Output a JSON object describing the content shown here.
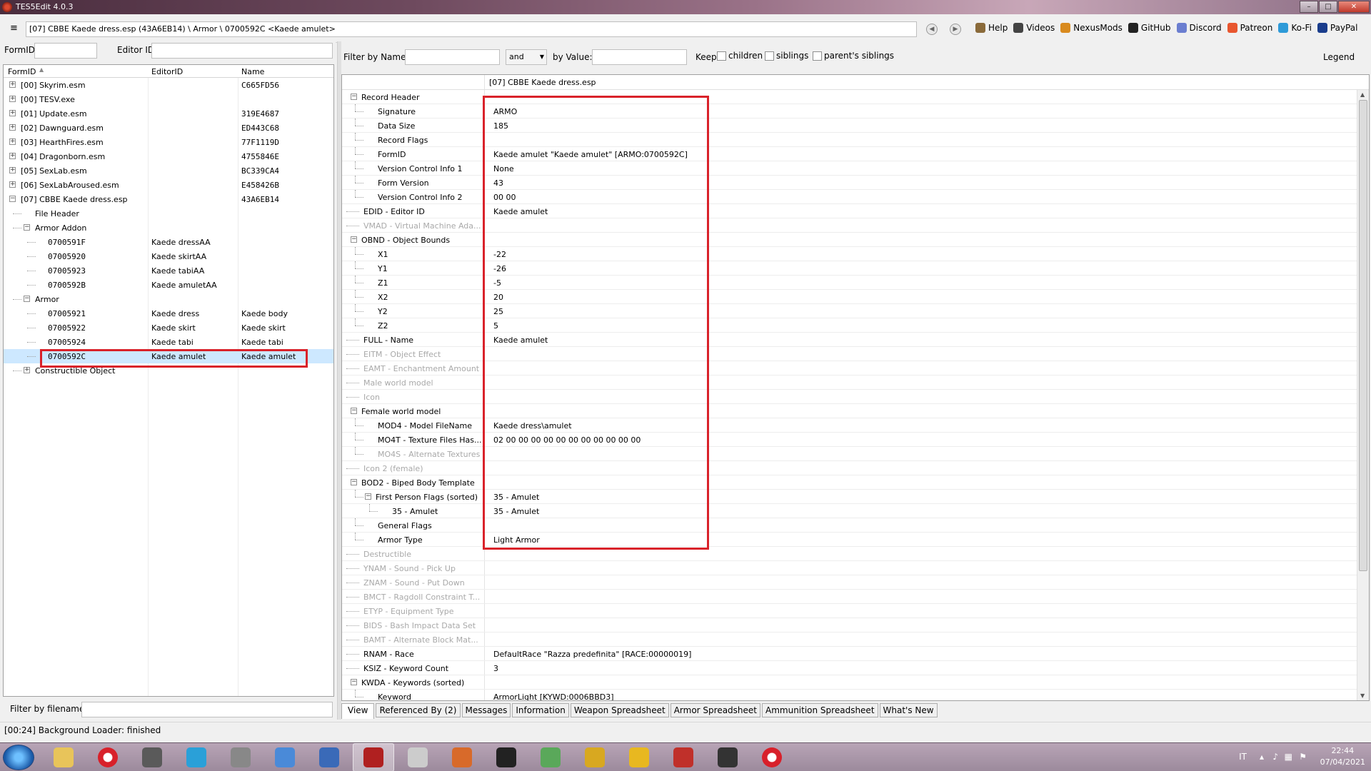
{
  "window": {
    "title": "TES5Edit 4.0.3"
  },
  "toolbar": {
    "path": "[07] CBBE Kaede dress.esp (43A6EB14) \\ Armor \\ 0700592C <Kaede amulet>",
    "links": [
      {
        "label": "Help",
        "icon": "book-icon",
        "color": "#8a6a3a"
      },
      {
        "label": "Videos",
        "icon": "video-icon",
        "color": "#444444"
      },
      {
        "label": "NexusMods",
        "icon": "nexus-icon",
        "color": "#d98a1e"
      },
      {
        "label": "GitHub",
        "icon": "github-icon",
        "color": "#222222"
      },
      {
        "label": "Discord",
        "icon": "discord-icon",
        "color": "#6b7ed0"
      },
      {
        "label": "Patreon",
        "icon": "patreon-icon",
        "color": "#e8562f"
      },
      {
        "label": "Ko-Fi",
        "icon": "kofi-icon",
        "color": "#2e9ad8"
      },
      {
        "label": "PayPal",
        "icon": "paypal-icon",
        "color": "#1a3d8c"
      }
    ],
    "legend": "Legend"
  },
  "left": {
    "formid_label": "FormID",
    "editorid_label": "Editor ID",
    "columns": [
      "FormID",
      "EditorID",
      "Name"
    ],
    "rows": [
      {
        "level": 0,
        "exp": "+",
        "formid": "[00] Skyrim.esm",
        "editorid": "",
        "name": "C665FD56",
        "mono": false
      },
      {
        "level": 0,
        "exp": "+",
        "formid": "[00] TESV.exe",
        "editorid": "",
        "name": "",
        "mono": false
      },
      {
        "level": 0,
        "exp": "+",
        "formid": "[01] Update.esm",
        "editorid": "",
        "name": "319E4687",
        "mono": false
      },
      {
        "level": 0,
        "exp": "+",
        "formid": "[02] Dawnguard.esm",
        "editorid": "",
        "name": "ED443C68",
        "mono": false
      },
      {
        "level": 0,
        "exp": "+",
        "formid": "[03] HearthFires.esm",
        "editorid": "",
        "name": "77F1119D",
        "mono": false
      },
      {
        "level": 0,
        "exp": "+",
        "formid": "[04] Dragonborn.esm",
        "editorid": "",
        "name": "4755846E",
        "mono": false
      },
      {
        "level": 0,
        "exp": "+",
        "formid": "[05] SexLab.esm",
        "editorid": "",
        "name": "BC339CA4",
        "mono": false
      },
      {
        "level": 0,
        "exp": "+",
        "formid": "[06] SexLabAroused.esm",
        "editorid": "",
        "name": "E458426B",
        "mono": false
      },
      {
        "level": 0,
        "exp": "-",
        "formid": "[07] CBBE Kaede dress.esp",
        "editorid": "",
        "name": "43A6EB14",
        "mono": false
      },
      {
        "level": 1,
        "exp": "",
        "formid": "File Header",
        "editorid": "",
        "name": "",
        "mono": false
      },
      {
        "level": 1,
        "exp": "-",
        "formid": "Armor Addon",
        "editorid": "",
        "name": "",
        "mono": false
      },
      {
        "level": 2,
        "exp": "",
        "formid": "0700591F",
        "editorid": "Kaede dressAA",
        "name": "",
        "mono": true
      },
      {
        "level": 2,
        "exp": "",
        "formid": "07005920",
        "editorid": "Kaede skirtAA",
        "name": "",
        "mono": true
      },
      {
        "level": 2,
        "exp": "",
        "formid": "07005923",
        "editorid": "Kaede tabiAA",
        "name": "",
        "mono": true
      },
      {
        "level": 2,
        "exp": "",
        "formid": "0700592B",
        "editorid": "Kaede amuletAA",
        "name": "",
        "mono": true
      },
      {
        "level": 1,
        "exp": "-",
        "formid": "Armor",
        "editorid": "",
        "name": "",
        "mono": false
      },
      {
        "level": 2,
        "exp": "",
        "formid": "07005921",
        "editorid": "Kaede dress",
        "name": "Kaede body",
        "mono": true
      },
      {
        "level": 2,
        "exp": "",
        "formid": "07005922",
        "editorid": "Kaede skirt",
        "name": "Kaede skirt",
        "mono": true
      },
      {
        "level": 2,
        "exp": "",
        "formid": "07005924",
        "editorid": "Kaede tabi",
        "name": "Kaede tabi",
        "mono": true
      },
      {
        "level": 2,
        "exp": "",
        "formid": "0700592C",
        "editorid": "Kaede amulet",
        "name": "Kaede amulet",
        "mono": true,
        "selected": true
      },
      {
        "level": 1,
        "exp": "+",
        "formid": "Constructible Object",
        "editorid": "",
        "name": "",
        "mono": false
      }
    ],
    "filter_label": "Filter by filename:"
  },
  "filter": {
    "by_name_label": "Filter by Name:",
    "and_value": "and",
    "by_value_label": "by Value:",
    "keep_label": "Keep",
    "children_label": "children",
    "siblings_label": "siblings",
    "parents_siblings_label": "parent's siblings"
  },
  "grid": {
    "column_header": "[07] CBBE Kaede dress.esp",
    "rows": [
      {
        "level": 0,
        "exp": "-",
        "name": "Record Header",
        "value": "",
        "dis": false
      },
      {
        "level": 1,
        "exp": "",
        "name": "Signature",
        "value": "ARMO",
        "dis": false
      },
      {
        "level": 1,
        "exp": "",
        "name": "Data Size",
        "value": "185",
        "dis": false
      },
      {
        "level": 1,
        "exp": "",
        "name": "Record Flags",
        "value": "",
        "dis": false
      },
      {
        "level": 1,
        "exp": "",
        "name": "FormID",
        "value": "Kaede amulet \"Kaede amulet\" [ARMO:0700592C]",
        "dis": false
      },
      {
        "level": 1,
        "exp": "",
        "name": "Version Control Info 1",
        "value": "None",
        "dis": false
      },
      {
        "level": 1,
        "exp": "",
        "name": "Form Version",
        "value": "43",
        "dis": false
      },
      {
        "level": 1,
        "exp": "",
        "name": "Version Control Info 2",
        "value": "00 00",
        "dis": false
      },
      {
        "level": 0,
        "exp": "",
        "name": "EDID - Editor ID",
        "value": "Kaede amulet",
        "dis": false
      },
      {
        "level": 0,
        "exp": "",
        "name": "VMAD - Virtual Machine Ada...",
        "value": "",
        "dis": true
      },
      {
        "level": 0,
        "exp": "-",
        "name": "OBND - Object Bounds",
        "value": "",
        "dis": false
      },
      {
        "level": 1,
        "exp": "",
        "name": "X1",
        "value": "-22",
        "dis": false
      },
      {
        "level": 1,
        "exp": "",
        "name": "Y1",
        "value": "-26",
        "dis": false
      },
      {
        "level": 1,
        "exp": "",
        "name": "Z1",
        "value": "-5",
        "dis": false
      },
      {
        "level": 1,
        "exp": "",
        "name": "X2",
        "value": "20",
        "dis": false
      },
      {
        "level": 1,
        "exp": "",
        "name": "Y2",
        "value": "25",
        "dis": false
      },
      {
        "level": 1,
        "exp": "",
        "name": "Z2",
        "value": "5",
        "dis": false
      },
      {
        "level": 0,
        "exp": "",
        "name": "FULL - Name",
        "value": "Kaede amulet",
        "dis": false
      },
      {
        "level": 0,
        "exp": "",
        "name": "EITM - Object Effect",
        "value": "",
        "dis": true
      },
      {
        "level": 0,
        "exp": "",
        "name": "EAMT - Enchantment Amount",
        "value": "",
        "dis": true
      },
      {
        "level": 0,
        "exp": "",
        "name": "Male world model",
        "value": "",
        "dis": true
      },
      {
        "level": 0,
        "exp": "",
        "name": "Icon",
        "value": "",
        "dis": true
      },
      {
        "level": 0,
        "exp": "-",
        "name": "Female world model",
        "value": "",
        "dis": false
      },
      {
        "level": 1,
        "exp": "",
        "name": "MOD4 - Model FileName",
        "value": "Kaede dress\\amulet",
        "dis": false
      },
      {
        "level": 1,
        "exp": "",
        "name": "MO4T - Texture Files Has...",
        "value": "02 00 00 00 00 00 00 00 00 00 00 00",
        "dis": false
      },
      {
        "level": 1,
        "exp": "",
        "name": "MO4S - Alternate Textures",
        "value": "",
        "dis": true
      },
      {
        "level": 0,
        "exp": "",
        "name": "Icon 2 (female)",
        "value": "",
        "dis": true
      },
      {
        "level": 0,
        "exp": "-",
        "name": "BOD2 - Biped Body Template",
        "value": "",
        "dis": false
      },
      {
        "level": 1,
        "exp": "-",
        "name": "First Person Flags (sorted)",
        "value": "35 - Amulet",
        "dis": false
      },
      {
        "level": 2,
        "exp": "",
        "name": "35 - Amulet",
        "value": "35 - Amulet",
        "dis": false
      },
      {
        "level": 1,
        "exp": "",
        "name": "General Flags",
        "value": "",
        "dis": false
      },
      {
        "level": 1,
        "exp": "",
        "name": "Armor Type",
        "value": "Light Armor",
        "dis": false
      },
      {
        "level": 0,
        "exp": "",
        "name": "Destructible",
        "value": "",
        "dis": true
      },
      {
        "level": 0,
        "exp": "",
        "name": "YNAM - Sound - Pick Up",
        "value": "",
        "dis": true
      },
      {
        "level": 0,
        "exp": "",
        "name": "ZNAM - Sound - Put Down",
        "value": "",
        "dis": true
      },
      {
        "level": 0,
        "exp": "",
        "name": "BMCT - Ragdoll Constraint T...",
        "value": "",
        "dis": true
      },
      {
        "level": 0,
        "exp": "",
        "name": "ETYP - Equipment Type",
        "value": "",
        "dis": true
      },
      {
        "level": 0,
        "exp": "",
        "name": "BIDS - Bash Impact Data Set",
        "value": "",
        "dis": true
      },
      {
        "level": 0,
        "exp": "",
        "name": "BAMT - Alternate Block Mat...",
        "value": "",
        "dis": true
      },
      {
        "level": 0,
        "exp": "",
        "name": "RNAM - Race",
        "value": "DefaultRace \"Razza predefinita\" [RACE:00000019]",
        "dis": false
      },
      {
        "level": 0,
        "exp": "",
        "name": "KSIZ - Keyword Count",
        "value": "3",
        "dis": false
      },
      {
        "level": 0,
        "exp": "-",
        "name": "KWDA - Keywords (sorted)",
        "value": "",
        "dis": false
      },
      {
        "level": 1,
        "exp": "",
        "name": "Keyword",
        "value": "ArmorLight [KYWD:0006BBD3]",
        "dis": false
      }
    ]
  },
  "tabs": [
    "View",
    "Referenced By (2)",
    "Messages",
    "Information",
    "Weapon Spreadsheet",
    "Armor Spreadsheet",
    "Ammunition Spreadsheet",
    "What's New"
  ],
  "status": {
    "text": "[00:24] Background Loader: finished"
  },
  "taskbar": {
    "apps": [
      {
        "name": "explorer-icon",
        "color": "#e8c45a"
      },
      {
        "name": "opera-icon",
        "color": "#d8202a"
      },
      {
        "name": "media-icon",
        "color": "#5a5a5a"
      },
      {
        "name": "music-icon",
        "color": "#2aa0d8"
      },
      {
        "name": "speaker-icon",
        "color": "#888888"
      },
      {
        "name": "ffdec-icon",
        "color": "#4a8ad8"
      },
      {
        "name": "pen-icon",
        "color": "#3a6ab8"
      },
      {
        "name": "tes5edit-icon",
        "color": "#b02020"
      },
      {
        "name": "robot-icon",
        "color": "#cccccc"
      },
      {
        "name": "headphones-icon",
        "color": "#d86a2a"
      },
      {
        "name": "mm-icon",
        "color": "#222222"
      },
      {
        "name": "calc-icon",
        "color": "#5aa85a"
      },
      {
        "name": "arrow-icon",
        "color": "#d8a820"
      },
      {
        "name": "ide-icon",
        "color": "#e8b820"
      },
      {
        "name": "filezilla-icon",
        "color": "#c0302a"
      },
      {
        "name": "creation-icon",
        "color": "#333333"
      },
      {
        "name": "opera2-icon",
        "color": "#d8202a"
      }
    ],
    "lang": "IT",
    "time": "22:44",
    "date": "07/04/2021"
  }
}
